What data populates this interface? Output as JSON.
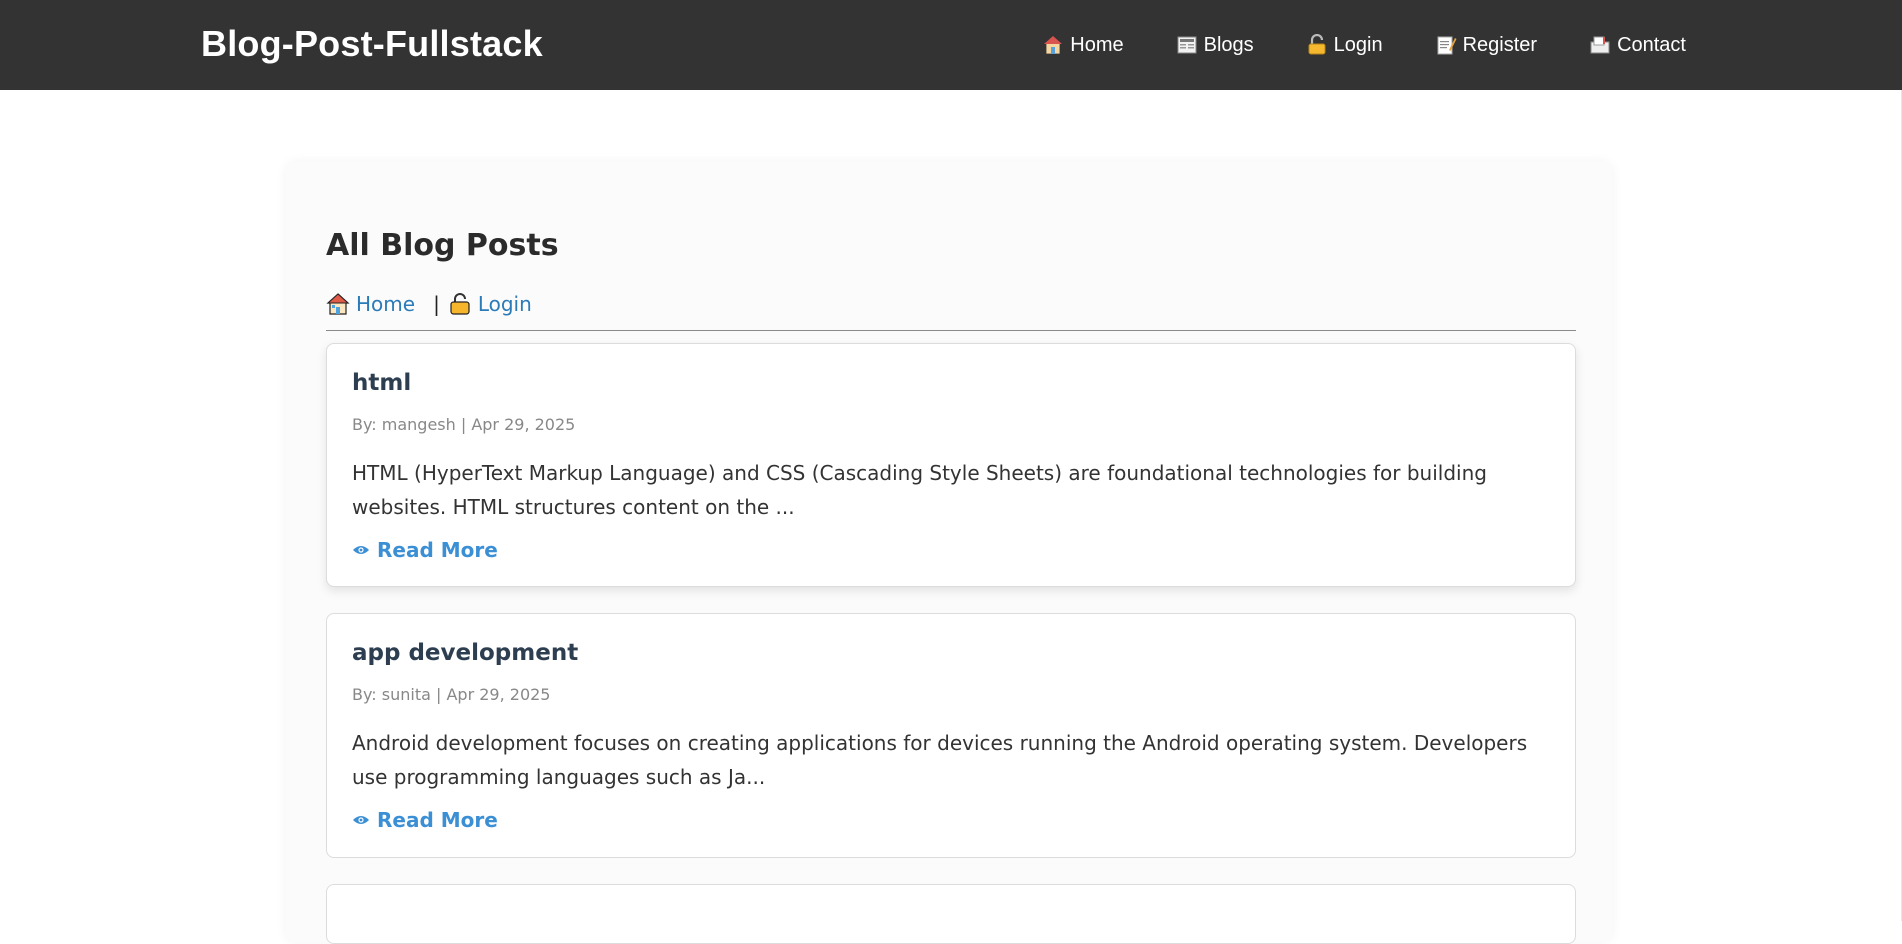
{
  "header": {
    "brand": "Blog-Post-Fullstack",
    "nav": [
      {
        "label": "Home",
        "icon": "house-icon"
      },
      {
        "label": "Blogs",
        "icon": "newspaper-icon"
      },
      {
        "label": "Login",
        "icon": "lock-icon"
      },
      {
        "label": "Register",
        "icon": "memo-icon"
      },
      {
        "label": "Contact",
        "icon": "mailbox-icon"
      }
    ]
  },
  "main": {
    "title": "All Blog Posts",
    "links": [
      {
        "label": "Home",
        "icon": "house-icon"
      },
      {
        "label": "Login",
        "icon": "lock-icon"
      }
    ],
    "separator": "|",
    "posts": [
      {
        "title": "html",
        "meta": "By: mangesh | Apr 29, 2025",
        "excerpt": "HTML (HyperText Markup Language) and CSS (Cascading Style Sheets) are foundational technologies for building websites. HTML structures content on the ...",
        "read_more": "Read More"
      },
      {
        "title": "app development",
        "meta": "By: sunita | Apr 29, 2025",
        "excerpt": "Android development focuses on creating applications for devices running the Android operating system. Developers use programming languages such as Ja...",
        "read_more": "Read More"
      }
    ]
  },
  "colors": {
    "navbar_bg": "#333333",
    "link": "#2b7bb9",
    "read_more": "#3b8fd4",
    "card_title": "#2c3e50"
  }
}
